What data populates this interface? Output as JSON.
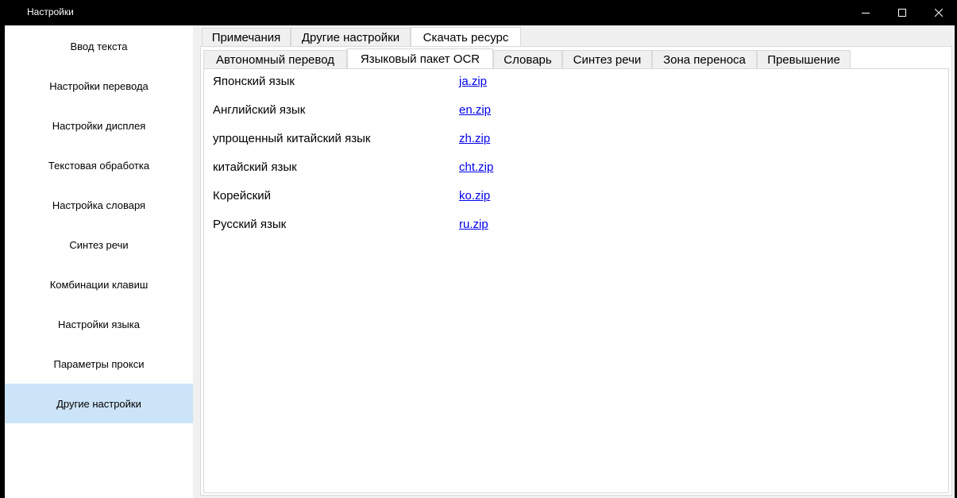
{
  "window": {
    "title": "Настройки",
    "controls": [
      "minimize-icon",
      "maximize-icon",
      "close-icon"
    ]
  },
  "sidebar": {
    "items": [
      {
        "label": "Ввод текста"
      },
      {
        "label": "Настройки перевода"
      },
      {
        "label": "Настройки дисплея"
      },
      {
        "label": "Текстовая обработка"
      },
      {
        "label": "Настройка словаря"
      },
      {
        "label": "Синтез речи"
      },
      {
        "label": "Комбинации клавиш"
      },
      {
        "label": "Настройки языка"
      },
      {
        "label": "Параметры прокси"
      },
      {
        "label": "Другие настройки",
        "selected": true
      }
    ]
  },
  "tabs": {
    "level1": [
      {
        "label": "Примечания"
      },
      {
        "label": "Другие настройки"
      },
      {
        "label": "Скачать ресурс",
        "active": true
      }
    ],
    "level2": [
      {
        "label": "Автономный перевод"
      },
      {
        "label": "Языковый пакет OCR",
        "active": true
      },
      {
        "label": "Словарь"
      },
      {
        "label": "Синтез речи"
      },
      {
        "label": "Зона переноса"
      },
      {
        "label": "Превышение"
      }
    ]
  },
  "ocr_packs": [
    {
      "language": "Японский язык",
      "file": "ja.zip"
    },
    {
      "language": "Английский язык",
      "file": "en.zip"
    },
    {
      "language": "упрощенный китайский язык",
      "file": "zh.zip"
    },
    {
      "language": "китайский язык",
      "file": "cht.zip"
    },
    {
      "language": "Корейский",
      "file": "ko.zip"
    },
    {
      "language": "Русский язык",
      "file": "ru.zip"
    }
  ],
  "colors": {
    "titlebar_bg": "#000000",
    "sidebar_selected": "#cce4f7",
    "link": "#0000ee",
    "tab_border": "#d9d9d9",
    "panel_bg": "#f0f0f0"
  }
}
